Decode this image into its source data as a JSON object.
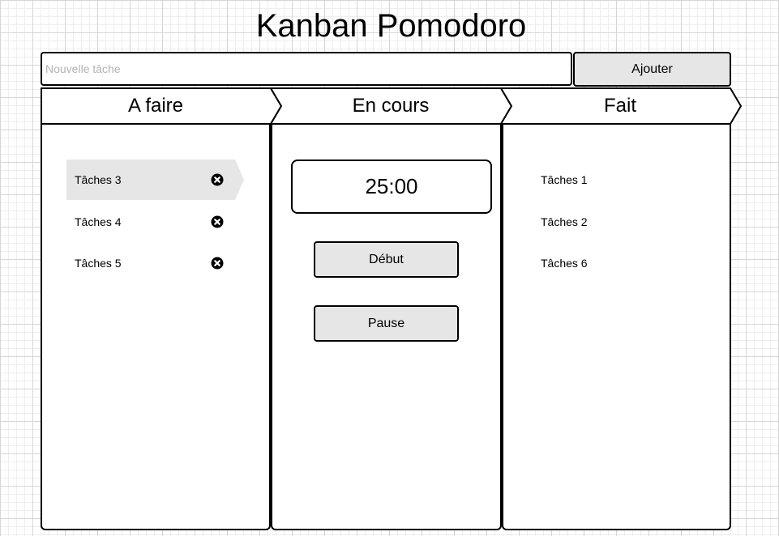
{
  "app": {
    "title": "Kanban Pomodoro"
  },
  "new_task": {
    "placeholder": "Nouvelle tâche",
    "value": "",
    "add_label": "Ajouter"
  },
  "columns": {
    "todo": {
      "title": "A faire",
      "items": [
        {
          "label": "Tâches 3",
          "active": true
        },
        {
          "label": "Tâches 4",
          "active": false
        },
        {
          "label": "Tâches 5",
          "active": false
        }
      ]
    },
    "doing": {
      "title": "En cours",
      "timer": "25:00",
      "start_label": "Début",
      "pause_label": "Pause"
    },
    "done": {
      "title": "Fait",
      "items": [
        {
          "label": "Tâches 1"
        },
        {
          "label": "Tâches 2"
        },
        {
          "label": "Tâches 6"
        }
      ]
    }
  },
  "icons": {
    "remove": "close-circle-icon"
  },
  "colors": {
    "border": "#000000",
    "button_bg": "#e6e6e6",
    "active_item_bg": "#e6e6e6",
    "placeholder": "#b3b3b3",
    "grid_major": "#d6d6d6",
    "grid_minor": "#eeeeee"
  }
}
